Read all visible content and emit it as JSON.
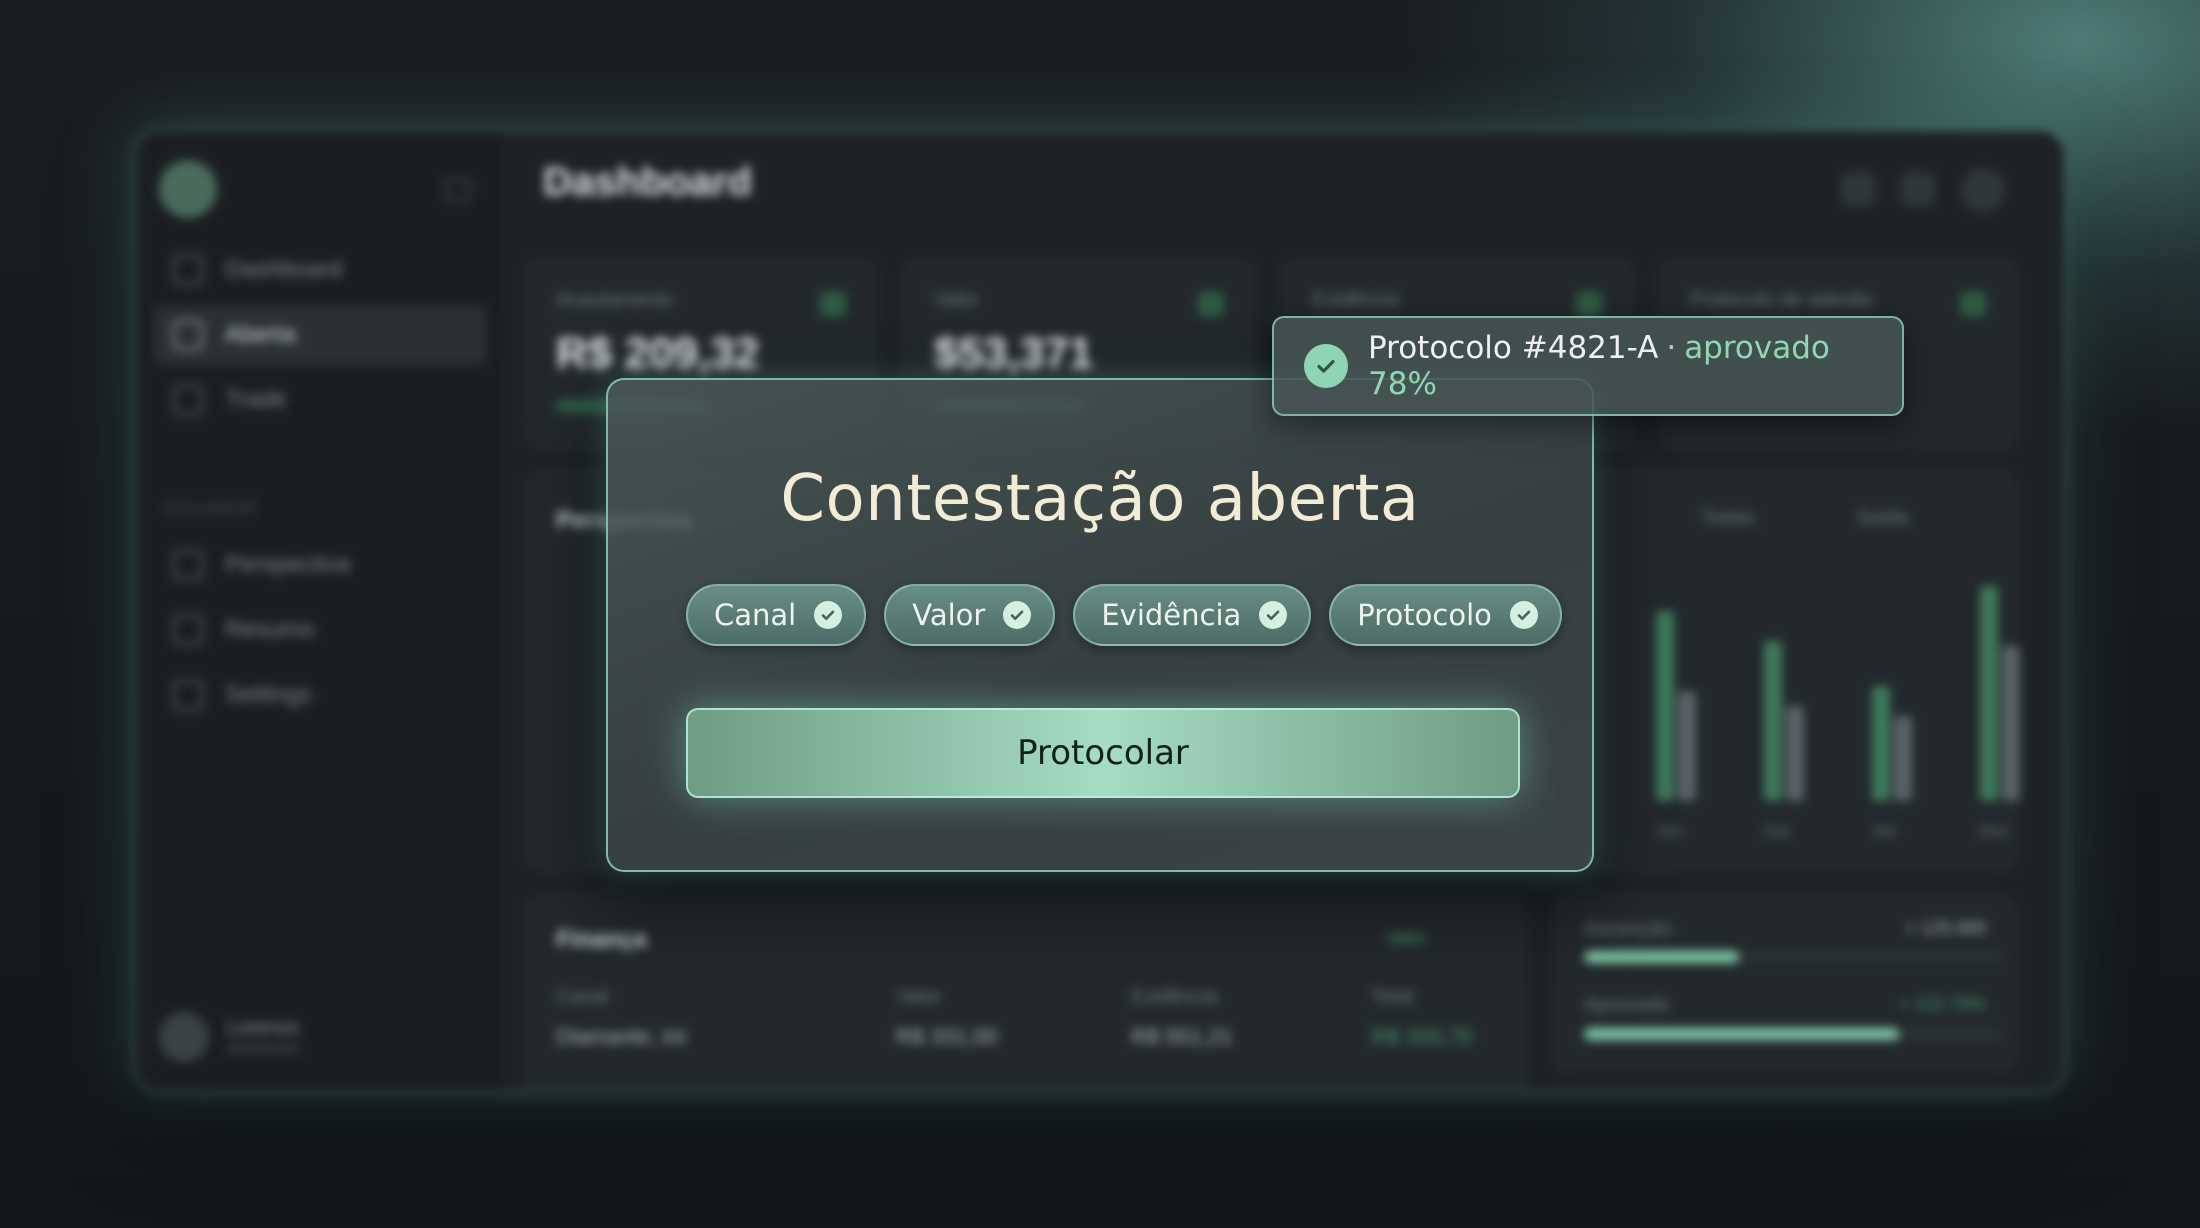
{
  "backdrop": {
    "title": "Dashboard",
    "nav": [
      "Dashboard",
      "Aberta",
      "Trade"
    ],
    "section_label": "ESCANDIR",
    "nav_secondary": [
      "Perspectiva",
      "Resumo",
      "Settings"
    ],
    "user": {
      "name": "Lorenzo",
      "role": "dashboard"
    },
    "kpis": [
      {
        "label": "Acautamento",
        "value": "R$ 209,32"
      },
      {
        "label": "Valor",
        "value": "$53,371"
      },
      {
        "label": "Evidência",
        "value": ""
      },
      {
        "label": "Protocolo de adesão",
        "value": ""
      }
    ],
    "chart": {
      "title": "Perspectiva",
      "filters": [
        "Todas",
        "Saída"
      ],
      "x_labels": [
        "Jun",
        "Out",
        "Set",
        "Dez"
      ]
    },
    "table": {
      "title": "Finança",
      "link": "Valor",
      "headers": [
        "Canal",
        "Valor",
        "Evidência",
        "Total"
      ],
      "row": [
        "Diamante, int",
        "R$ 331,00",
        "R$ 551,21",
        "R$ 333,70"
      ]
    },
    "progress": [
      {
        "label": "Ascenção",
        "value": "+ 125.000",
        "fraction": 0.37
      },
      {
        "label": "Aprovado",
        "value": "+ 122.70%",
        "fraction": 0.75
      }
    ],
    "colors": {
      "accent": "#8fd8b4",
      "title": "#f2ecd7"
    }
  },
  "modal": {
    "title": "Contestação aberta",
    "chips": [
      {
        "label": "Canal",
        "icon": "check-icon"
      },
      {
        "label": "Valor",
        "icon": "check-icon"
      },
      {
        "label": "Evidência",
        "icon": "check-icon"
      },
      {
        "label": "Protocolo",
        "icon": "check-icon"
      }
    ],
    "primary_button": "Protocolar"
  },
  "toast": {
    "protocol": "Protocolo #4821-A",
    "separator": "·",
    "status": "aprovado 78%"
  }
}
